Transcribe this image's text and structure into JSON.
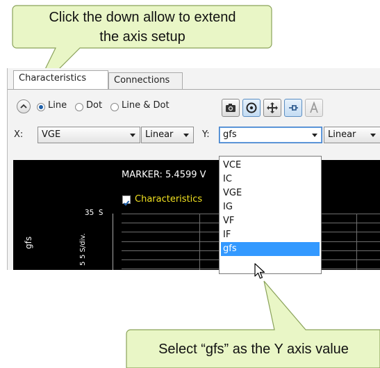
{
  "callouts": {
    "top_line1": "Click the down allow to extend",
    "top_line2": "the axis setup",
    "bottom": "Select “gfs” as the Y axis value"
  },
  "tabs": [
    {
      "label": "Characteristics",
      "active": true
    },
    {
      "label": "Connections",
      "active": false
    }
  ],
  "plot_style": {
    "options": [
      "Line",
      "Dot",
      "Line & Dot"
    ],
    "selected": "Line"
  },
  "toolbar": {
    "buttons": [
      "camera-icon",
      "marker-target-icon",
      "move-arrows-icon",
      "pin-icon",
      "text-a-icon"
    ]
  },
  "axis_setup": {
    "x_label": "X:",
    "x_value": "VGE",
    "x_scale": "Linear",
    "y_label": "Y:",
    "y_value": "gfs",
    "y_scale": "Linear"
  },
  "y_dropdown": {
    "options": [
      "VCE",
      "IC",
      "VGE",
      "IG",
      "VF",
      "IF",
      "gfs"
    ],
    "highlighted": "gfs"
  },
  "graph": {
    "marker_text": "MARKER: 5.4599 V",
    "legend": "Characteristics",
    "y_top_tick": "35 S",
    "y_axis_name": "gfs",
    "y_div": "5 S/div.",
    "y_bottom": "5"
  },
  "colors": {
    "callout_fill": "#e9f6c6",
    "selection": "#3399ff",
    "legend_text": "#f0e020"
  }
}
